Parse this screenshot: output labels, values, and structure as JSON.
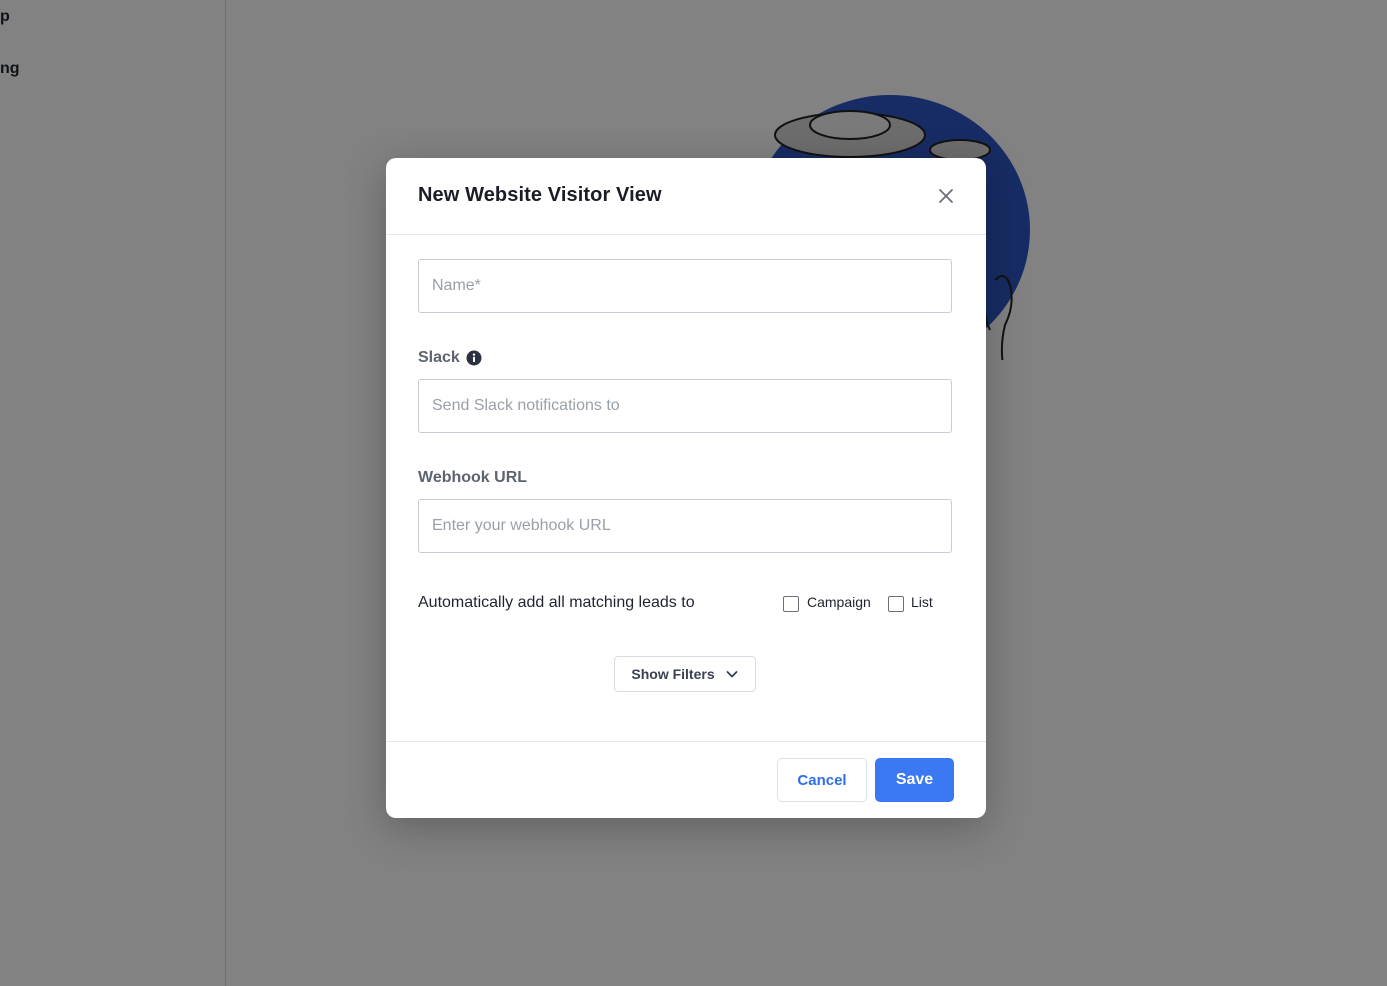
{
  "background": {
    "nav_items": [
      "p",
      "ng"
    ]
  },
  "modal": {
    "title": "New Website Visitor View",
    "name_field": {
      "placeholder": "Name*",
      "value": ""
    },
    "slack": {
      "label": "Slack",
      "placeholder": "Send Slack notifications to"
    },
    "webhook": {
      "label": "Webhook URL",
      "placeholder": "Enter your webhook URL"
    },
    "auto_add": {
      "text": "Automatically add all matching leads to",
      "options": [
        {
          "label": "Campaign",
          "checked": false
        },
        {
          "label": "List",
          "checked": false
        }
      ]
    },
    "show_filters_label": "Show Filters",
    "cancel_label": "Cancel",
    "save_label": "Save"
  },
  "colors": {
    "accent": "#3b79f2",
    "illustration_blue": "#2e57c4"
  }
}
